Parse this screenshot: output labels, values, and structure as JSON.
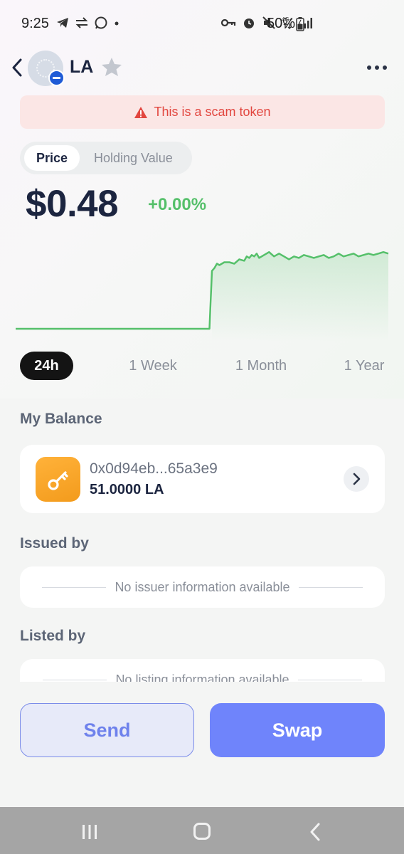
{
  "status_bar": {
    "time": "9:25",
    "battery": "50%"
  },
  "header": {
    "title": "LA"
  },
  "warning": {
    "text": "This is a scam token",
    "color": "#e2463f"
  },
  "price_toggle": {
    "options": [
      "Price",
      "Holding Value"
    ],
    "selected": "Price"
  },
  "price": {
    "value": "$0.48",
    "change": "+0.00%",
    "change_color": "#55c06a"
  },
  "chart_data": {
    "type": "line",
    "x": [
      0,
      78,
      79,
      80,
      81,
      82,
      84,
      86,
      88,
      90,
      92,
      93,
      94,
      95,
      96,
      97,
      98,
      100,
      102,
      104,
      106,
      108,
      110,
      112,
      114,
      116,
      118,
      120,
      122,
      124,
      126,
      128,
      130,
      132,
      134,
      136,
      138,
      140,
      142,
      144,
      146,
      148,
      150
    ],
    "values": [
      0.0,
      0.0,
      0.4,
      0.42,
      0.45,
      0.44,
      0.46,
      0.46,
      0.45,
      0.48,
      0.47,
      0.5,
      0.49,
      0.51,
      0.5,
      0.52,
      0.49,
      0.51,
      0.53,
      0.5,
      0.52,
      0.5,
      0.48,
      0.5,
      0.49,
      0.51,
      0.5,
      0.49,
      0.5,
      0.51,
      0.49,
      0.5,
      0.52,
      0.5,
      0.51,
      0.52,
      0.5,
      0.51,
      0.52,
      0.51,
      0.52,
      0.53,
      0.52
    ],
    "ylim": [
      0,
      0.6
    ],
    "color": "#55c06a",
    "grid": false,
    "title": "",
    "xlabel": "",
    "ylabel": ""
  },
  "ranges": {
    "items": [
      "24h",
      "1 Week",
      "1 Month",
      "1 Year"
    ],
    "selected": "24h"
  },
  "balance": {
    "title": "My Balance",
    "address": "0x0d94eb...65a3e9",
    "amount": "51.0000 LA",
    "icon": "key-icon",
    "icon_color": "#f7a22a"
  },
  "issued": {
    "title": "Issued by",
    "text": "No issuer information available"
  },
  "listed": {
    "title": "Listed by",
    "text": "No listing information available"
  },
  "actions": {
    "send": "Send",
    "swap": "Swap"
  }
}
